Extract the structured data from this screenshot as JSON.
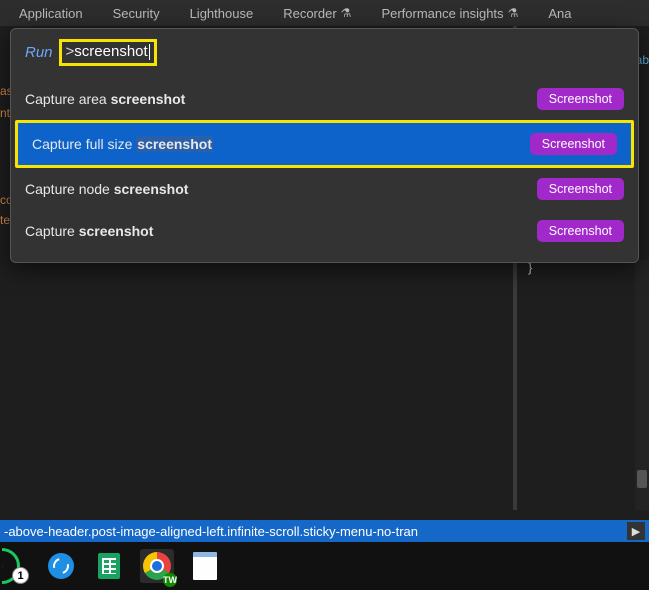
{
  "tabs": [
    "Application",
    "Security",
    "Lighthouse",
    "Recorder",
    "Performance insights",
    "Ana"
  ],
  "tab_flask_indices": [
    3,
    4
  ],
  "command_menu": {
    "prefix_label": "Run",
    "prefix_symbol": ">",
    "query": "screenshot",
    "badge_label": "Screenshot",
    "items": [
      {
        "pre": "Capture area ",
        "match": "screenshot",
        "post": ""
      },
      {
        "pre": "Capture full size ",
        "match": "screenshot",
        "post": ""
      },
      {
        "pre": "Capture node ",
        "match": "screenshot",
        "post": ""
      },
      {
        "pre": "Capture ",
        "match": "screenshot",
        "post": ""
      }
    ],
    "selected_index": 1
  },
  "background_code": {
    "left_fragments": [
      "as",
      "nt"
    ],
    "left_fragments2": [
      "co",
      "te"
    ],
    "closing_brace": "}",
    "right_fragment": "ab"
  },
  "status_bar": {
    "text": "-above-header.post-image-aligned-left.infinite-scroll.sticky-menu-no-tran",
    "arrow": "▶"
  },
  "taskbar": {
    "badge_count": "1",
    "chrome_overlay": "TW"
  }
}
